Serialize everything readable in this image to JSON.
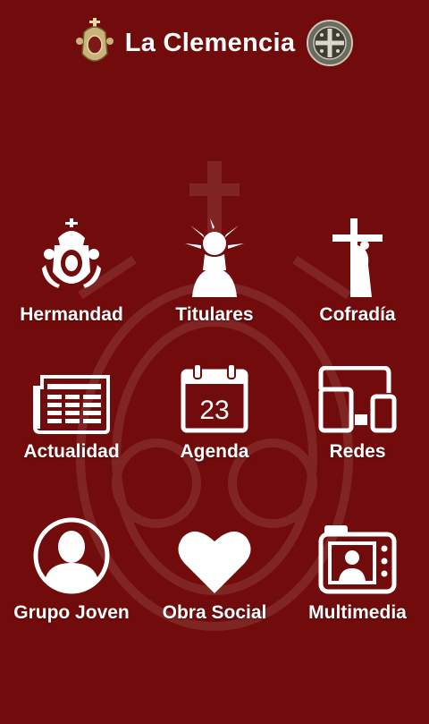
{
  "header": {
    "title": "La Clemencia",
    "left_emblem": "brotherhood-crest-icon",
    "right_emblem": "saint-benedict-medal-icon"
  },
  "colors": {
    "background": "#720b0b",
    "icon": "#ffffff",
    "text": "#ffffff"
  },
  "menu": [
    {
      "label": "Hermandad",
      "icon": "crest-icon"
    },
    {
      "label": "Titulares",
      "icon": "christ-figure-icon"
    },
    {
      "label": "Cofradía",
      "icon": "cross-icon"
    },
    {
      "label": "Actualidad",
      "icon": "newspaper-icon"
    },
    {
      "label": "Agenda",
      "icon": "calendar-icon",
      "calendar_day": "23"
    },
    {
      "label": "Redes",
      "icon": "devices-icon"
    },
    {
      "label": "Grupo Joven",
      "icon": "user-icon"
    },
    {
      "label": "Obra Social",
      "icon": "heart-icon"
    },
    {
      "label": "Multimedia",
      "icon": "camera-icon"
    }
  ]
}
